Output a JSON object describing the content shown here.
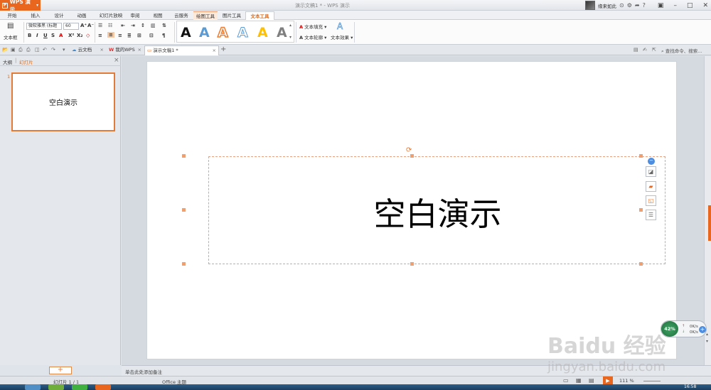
{
  "titlebar": {
    "app_name": "WPS 演示",
    "doc_title": "演示文稿1 * - WPS 演示",
    "user_name": "缘来如此"
  },
  "menu": {
    "tabs": [
      "开始",
      "插入",
      "设计",
      "动画",
      "幻灯片放映",
      "审阅",
      "视图",
      "云服务",
      "绘图工具",
      "图片工具",
      "文本工具"
    ],
    "active": "文本工具"
  },
  "ribbon": {
    "textbox_label": "文本框",
    "font_name": "微软雅黑 (标题",
    "font_size": "60",
    "text_fill": "文本填充",
    "text_outline": "文本轮廓",
    "text_effect": "文本效果",
    "style_letter": "A"
  },
  "doc_tabs": {
    "cloud_doc": "云文档",
    "my_wps": "我的WPS",
    "active_doc": "演示文稿1 *",
    "search_cmd": "查找命令、搜索..."
  },
  "left_panel": {
    "tab_outline": "大纲",
    "tab_slides": "幻灯片",
    "slide_number": "1",
    "thumb_title": "空白演示",
    "add_slide": "+"
  },
  "slide": {
    "title": "空白演示"
  },
  "notes": {
    "placeholder": "单击此处添加备注"
  },
  "status": {
    "slide_indicator": "幻灯片 1 / 1",
    "theme": "Office 主题",
    "zoom": "111 %"
  },
  "speed_widget": {
    "percent": "42%",
    "up": "0K/s",
    "down": "0K/s"
  },
  "taskbar": {
    "clock": "16:58"
  },
  "watermark": {
    "logo": "Baidu 经验",
    "url": "jingyan.baidu.com"
  },
  "colors": {
    "accent": "#e9661f",
    "selection": "#e07b39"
  }
}
